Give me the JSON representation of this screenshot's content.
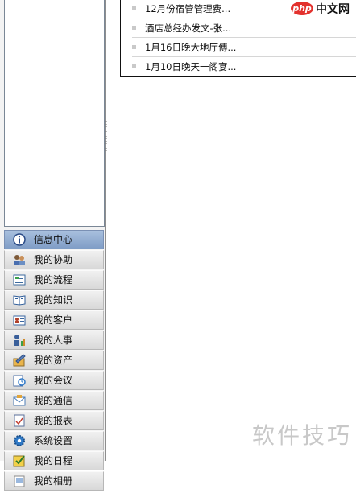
{
  "news": {
    "items": [
      {
        "title": "12月份宿管管理费..."
      },
      {
        "title": "酒店总经办发文-张..."
      },
      {
        "title": "1月16日晚大地厅傅..."
      },
      {
        "title": "1月10日晚天一阁宴..."
      }
    ]
  },
  "nav": {
    "items": [
      {
        "label": "信息中心",
        "icon": "info-icon",
        "active": true
      },
      {
        "label": "我的协助",
        "icon": "people-icon"
      },
      {
        "label": "我的流程",
        "icon": "form-icon"
      },
      {
        "label": "我的知识",
        "icon": "book-icon"
      },
      {
        "label": "我的客户",
        "icon": "contact-card-icon"
      },
      {
        "label": "我的人事",
        "icon": "person-chart-icon"
      },
      {
        "label": "我的资产",
        "icon": "pen-box-icon"
      },
      {
        "label": "我的会议",
        "icon": "meeting-icon"
      },
      {
        "label": "我的通信",
        "icon": "mail-icon"
      },
      {
        "label": "我的报表",
        "icon": "report-icon"
      },
      {
        "label": "系统设置",
        "icon": "gear-icon"
      },
      {
        "label": "我的日程",
        "icon": "checkbox-icon"
      },
      {
        "label": "我的相册",
        "icon": "album-icon"
      }
    ]
  },
  "watermark": {
    "badge": "php",
    "site": "中文网",
    "bottom": "软件技巧"
  },
  "colors": {
    "active_nav": "#8fabd2",
    "php_red": "#e3312d"
  }
}
